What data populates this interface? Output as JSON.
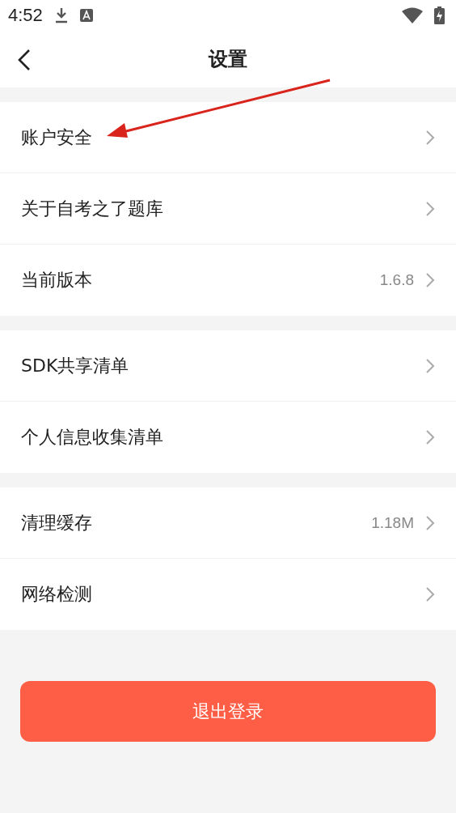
{
  "status_bar": {
    "time": "4:52"
  },
  "header": {
    "title": "设置"
  },
  "groups": [
    {
      "items": [
        {
          "label": "账户安全"
        },
        {
          "label": "关于自考之了题库"
        },
        {
          "label": "当前版本",
          "value": "1.6.8"
        }
      ]
    },
    {
      "items": [
        {
          "label": "SDK共享清单"
        },
        {
          "label": "个人信息收集清单"
        }
      ]
    },
    {
      "items": [
        {
          "label": "清理缓存",
          "value": "1.18M"
        },
        {
          "label": "网络检测"
        }
      ]
    }
  ],
  "logout_button": {
    "label": "退出登录"
  }
}
